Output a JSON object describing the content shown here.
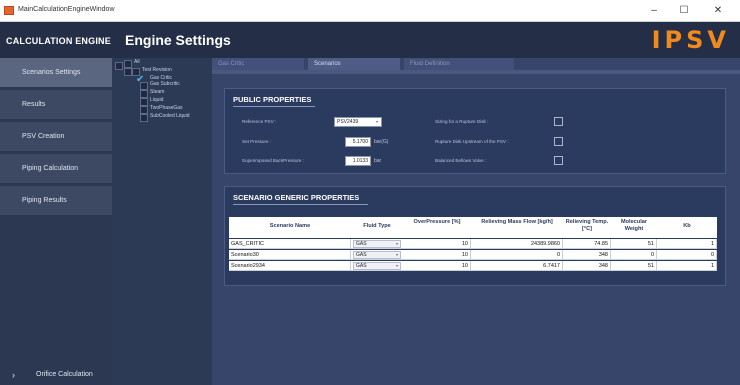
{
  "window": {
    "title": "MainCalculationEngineWindow",
    "controls": [
      "–",
      "☐",
      "✕"
    ]
  },
  "header": {
    "brand": "CALCULATION ENGINE",
    "page_title": "Engine Settings",
    "logo": "IPSV",
    "logo_color": "#f08a1c"
  },
  "sidebar": {
    "items": [
      {
        "label": "Scenarios Settings",
        "active": true
      },
      {
        "label": "Results",
        "active": false
      },
      {
        "label": "PSV Creation",
        "active": false
      },
      {
        "label": "Piping Calculation",
        "active": false
      },
      {
        "label": "Piping Results",
        "active": false
      }
    ],
    "footer": {
      "label": "Orifice Calculation",
      "icon": "chevron-right-icon"
    }
  },
  "tree": {
    "root": "All",
    "items": [
      "Test Revision",
      "Gas Critic",
      "Gas Subcritic",
      "Steam",
      "Liquid",
      "TwoPhaseGas",
      "SubCooled Liquid"
    ]
  },
  "tabs": [
    "Gas Critic",
    "Scenarios",
    "Fluid Definition"
  ],
  "public_properties": {
    "title": "PUBLIC PROPERTIES",
    "reference_psv_label": "Reference PSV :",
    "reference_psv_value": "PSV2439",
    "set_pressure_label": "Set Pressure :",
    "set_pressure_value": "5.1700",
    "set_pressure_unit": "bar(G)",
    "superimposed_label": "Superimposed BackPressure :",
    "superimposed_value": "1.0133",
    "superimposed_unit": "bar",
    "sizing_rupture_label": "Sizing for a Rupture Disk :",
    "rupture_upstream_label": "Rupture Disk Upstream of the PSV :",
    "balanced_bellows_label": "Balanced Bellows Valve :"
  },
  "scenario_properties": {
    "title": "SCENARIO GENERIC PROPERTIES",
    "columns": [
      "Scenario Name",
      "Fluid Type",
      "OverPressure [%]",
      "Relieving Mass Flow [kg/h]",
      "Relieving Temp. [°C]",
      "Molecular Weight",
      "Kb"
    ],
    "rows": [
      {
        "name": "GAS_CRITIC",
        "fluid": "GAS",
        "overpressure": "10",
        "mass_flow": "24389.9860",
        "temp": "74.85",
        "mw": "51",
        "kb": "1"
      },
      {
        "name": "Scenario30",
        "fluid": "GAS",
        "overpressure": "10",
        "mass_flow": "0",
        "temp": "348",
        "mw": "0",
        "kb": "0"
      },
      {
        "name": "Scenario2934",
        "fluid": "GAS",
        "overpressure": "10",
        "mass_flow": "6.7417",
        "temp": "348",
        "mw": "51",
        "kb": "1"
      }
    ]
  }
}
